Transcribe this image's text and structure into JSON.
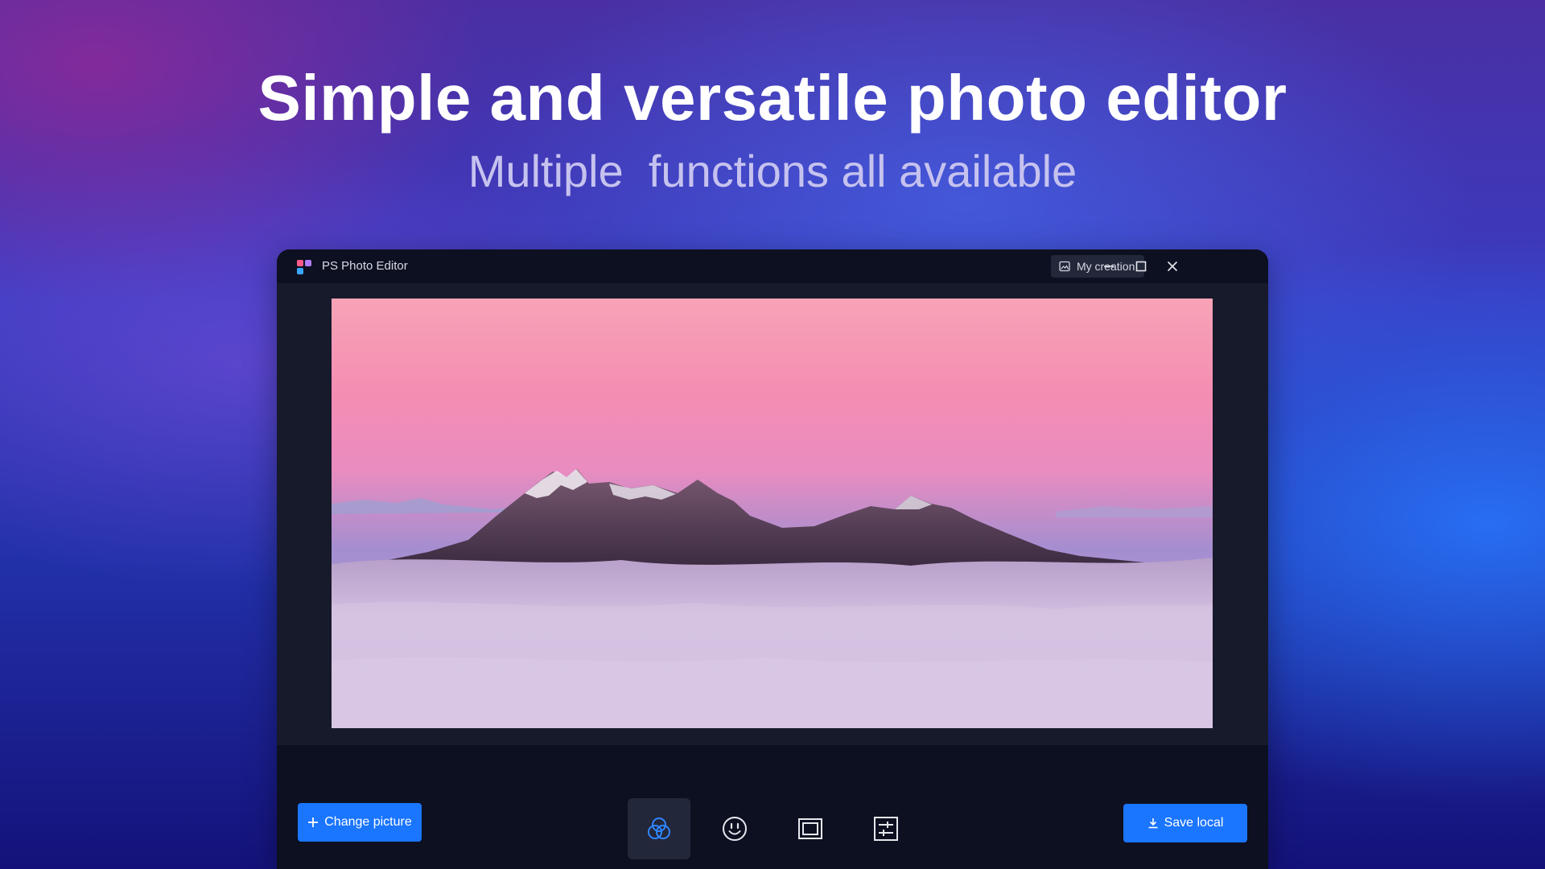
{
  "hero": {
    "title": "Simple and versatile photo editor",
    "subtitle": "Multiple  functions all available"
  },
  "window": {
    "app_title": "PS Photo Editor",
    "app_icon": "ps-photo-editor-logo",
    "my_creation": {
      "label": "My creation",
      "icon": "image-icon"
    },
    "controls": [
      "minimize-icon",
      "maximize-icon",
      "close-icon"
    ]
  },
  "canvas": {
    "image": "mountain-above-clouds-at-sunset"
  },
  "toolbar": {
    "change_picture_label": "Change picture",
    "save_local_label": "Save local",
    "tools": [
      {
        "name": "filter",
        "icon": "filter-icon",
        "active": true
      },
      {
        "name": "sticker",
        "icon": "sticker-icon",
        "active": false
      },
      {
        "name": "frame",
        "icon": "frame-icon",
        "active": false
      },
      {
        "name": "adjust",
        "icon": "adjust-icon",
        "active": false
      }
    ]
  },
  "colors": {
    "accent": "#1a75ff",
    "window_bg": "#0d1020",
    "canvas_bg": "#171a2b",
    "button_secondary": "#23273a"
  }
}
